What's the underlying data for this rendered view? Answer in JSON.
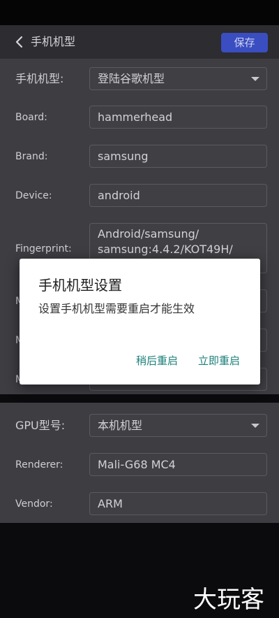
{
  "app_bar": {
    "title": "手机机型",
    "save_label": "保存"
  },
  "device_form": {
    "model": {
      "label": "手机机型:",
      "value": "登陆谷歌机型"
    },
    "board": {
      "label": "Board:",
      "value": "hammerhead"
    },
    "brand": {
      "label": "Brand:",
      "value": "samsung"
    },
    "device": {
      "label": "Device:",
      "value": "android"
    },
    "fingerprint": {
      "label": "Fingerprint:",
      "value": "Android/samsung/ samsung:4.4.2/KOT49H/"
    },
    "partial_labels": [
      "M",
      "M",
      "M"
    ]
  },
  "gpu_form": {
    "gpu": {
      "label": "GPU型号:",
      "value": "本机机型"
    },
    "renderer": {
      "label": "Renderer:",
      "value": "Mali-G68 MC4"
    },
    "vendor": {
      "label": "Vendor:",
      "value": "ARM"
    }
  },
  "dialog": {
    "title": "手机机型设置",
    "message": "设置手机机型需要重启才能生效",
    "later_label": "稍后重启",
    "now_label": "立即重启"
  },
  "watermark": "大玩客"
}
